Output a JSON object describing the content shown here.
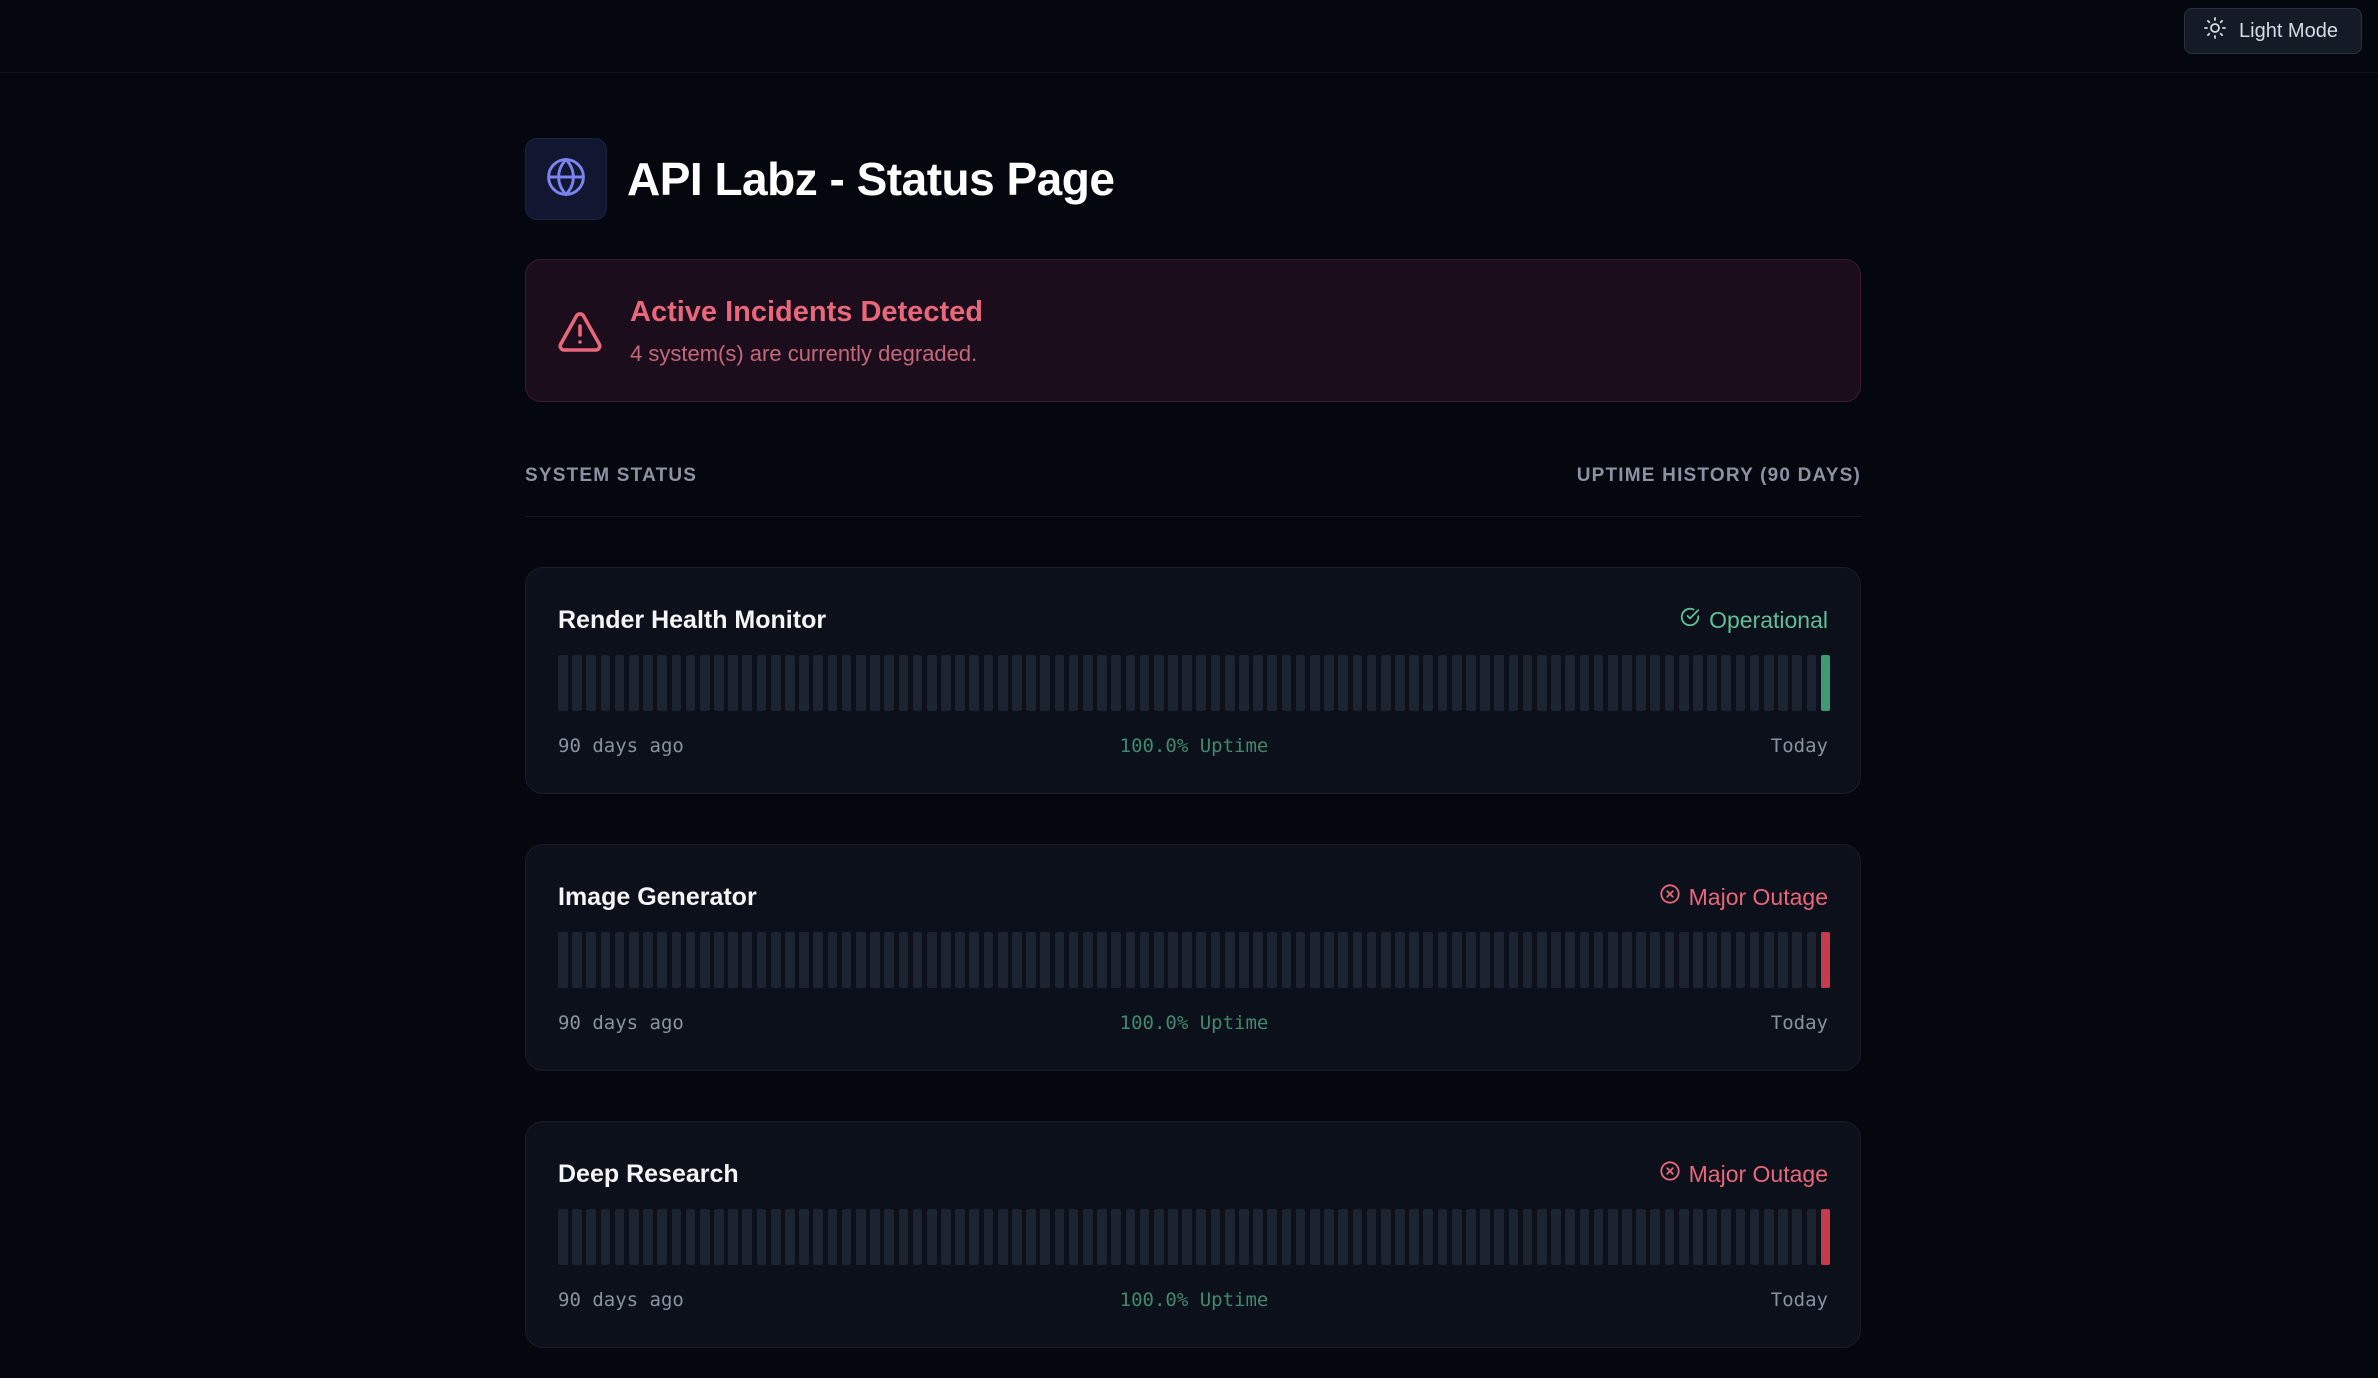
{
  "topbar": {
    "theme_toggle": {
      "label": "Light Mode",
      "icon": "sun-icon"
    }
  },
  "header": {
    "title": "API Labz - Status Page",
    "logo_icon": "globe-icon",
    "logo_color": "#7c83f0"
  },
  "incident_banner": {
    "title": "Active Incidents Detected",
    "message": "4 system(s) are currently degraded.",
    "icon": "warning-triangle-icon",
    "color": "#e8677a"
  },
  "section": {
    "left_label": "SYSTEM STATUS",
    "right_label": "UPTIME HISTORY (90 DAYS)"
  },
  "colors": {
    "operational": "#5fbf96",
    "outage": "#e8677a",
    "bar_empty": "#1d2431",
    "bar_operational": "#3f9a72",
    "bar_outage": "#c23b4f"
  },
  "systems": [
    {
      "name": "Render Health Monitor",
      "status": "Operational",
      "status_type": "operational",
      "status_icon": "check-circle-icon",
      "range_start": "90 days ago",
      "uptime": "100.0% Uptime",
      "range_end": "Today",
      "bar_count": 90,
      "today_state": "operational"
    },
    {
      "name": "Image Generator",
      "status": "Major Outage",
      "status_type": "outage",
      "status_icon": "x-circle-icon",
      "range_start": "90 days ago",
      "uptime": "100.0% Uptime",
      "range_end": "Today",
      "bar_count": 90,
      "today_state": "outage"
    },
    {
      "name": "Deep Research",
      "status": "Major Outage",
      "status_type": "outage",
      "status_icon": "x-circle-icon",
      "range_start": "90 days ago",
      "uptime": "100.0% Uptime",
      "range_end": "Today",
      "bar_count": 90,
      "today_state": "outage"
    }
  ]
}
